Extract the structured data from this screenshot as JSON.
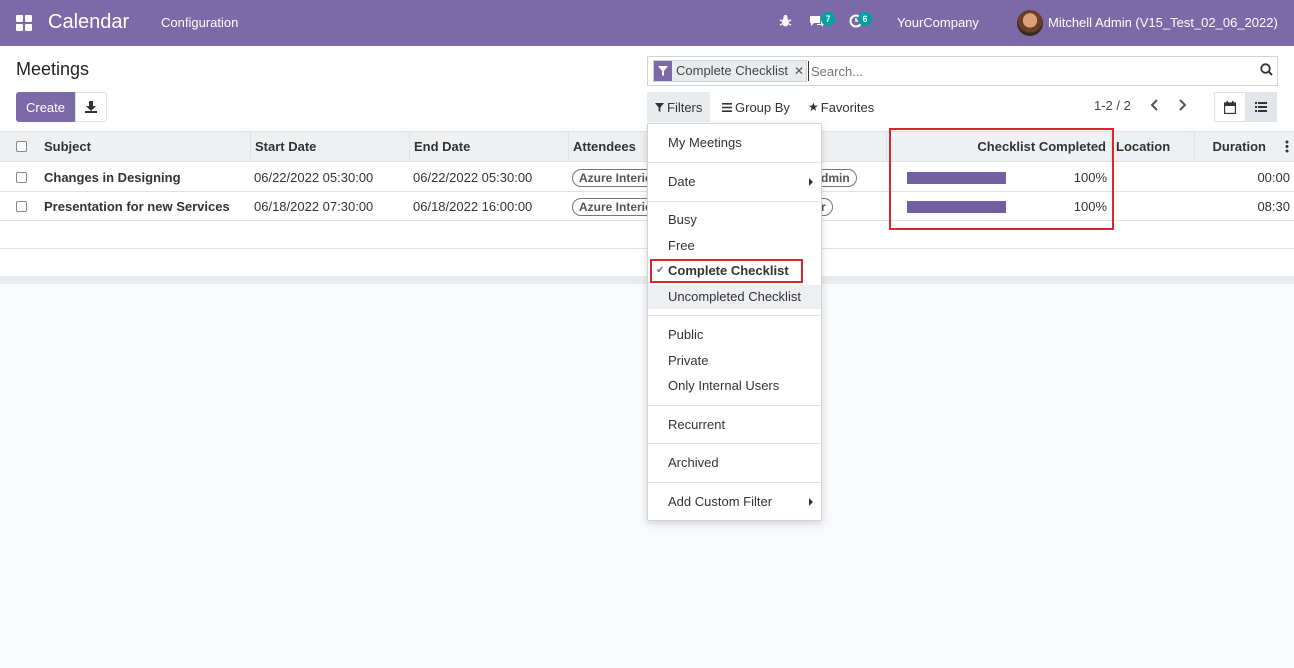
{
  "navbar": {
    "app_title": "Calendar",
    "menu_configuration": "Configuration",
    "messages_count": "7",
    "activities_count": "6",
    "company": "YourCompany",
    "user": "Mitchell Admin (V15_Test_02_06_2022)"
  },
  "control_panel": {
    "breadcrumb": "Meetings",
    "create_label": "Create",
    "search_facet": "Complete Checklist",
    "search_placeholder": "Search...",
    "filters_label": "Filters",
    "group_by_label": "Group By",
    "favorites_label": "Favorites",
    "pager": "1-2 / 2"
  },
  "table": {
    "headers": {
      "subject": "Subject",
      "start_date": "Start Date",
      "end_date": "End Date",
      "attendees": "Attendees",
      "checklist_completed": "Checklist Completed",
      "location": "Location",
      "duration": "Duration"
    },
    "rows": [
      {
        "subject": "Changes in Designing",
        "start_date": "06/22/2022 05:30:00",
        "end_date": "06/22/2022 05:30:00",
        "attendee_tag": "Azure Interio",
        "attendee_tag2": "dmin",
        "checklist_progress": 1.0,
        "checklist_label": "100%",
        "duration": "00:00"
      },
      {
        "subject": "Presentation for new Services",
        "start_date": "06/18/2022 07:30:00",
        "end_date": "06/18/2022 16:00:00",
        "attendee_tag": "Azure Interio",
        "attendee_tag2": "r",
        "checklist_progress": 1.0,
        "checklist_label": "100%",
        "duration": "08:30"
      }
    ]
  },
  "filters_dropdown": {
    "my_meetings": "My Meetings",
    "date": "Date",
    "busy": "Busy",
    "free": "Free",
    "complete_checklist": "Complete Checklist",
    "uncompleted_checklist": "Uncompleted Checklist",
    "public": "Public",
    "private": "Private",
    "only_internal_users": "Only Internal Users",
    "recurrent": "Recurrent",
    "archived": "Archived",
    "add_custom_filter": "Add Custom Filter"
  },
  "colors": {
    "brand": "#7c6aa8",
    "highlight": "#d9262c",
    "badge": "#01a19c"
  }
}
